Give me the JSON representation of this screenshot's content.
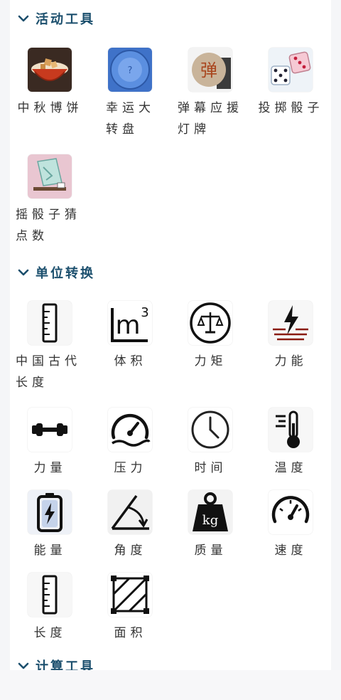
{
  "sections": [
    {
      "title": "活动工具",
      "items": [
        {
          "label": "中秋博饼"
        },
        {
          "label": "幸运大转盘"
        },
        {
          "label": "弹幕应援灯牌"
        },
        {
          "label": "投掷骰子"
        },
        {
          "label": "摇骰子猜点数"
        }
      ]
    },
    {
      "title": "单位转换",
      "items": [
        {
          "label": "中国古代长度"
        },
        {
          "label": "体积"
        },
        {
          "label": "力矩"
        },
        {
          "label": "力能"
        },
        {
          "label": "力量"
        },
        {
          "label": "压力"
        },
        {
          "label": "时间"
        },
        {
          "label": "温度"
        },
        {
          "label": "能量"
        },
        {
          "label": "角度"
        },
        {
          "label": "质量"
        },
        {
          "label": "速度"
        },
        {
          "label": "长度"
        },
        {
          "label": "面积"
        }
      ]
    },
    {
      "title": "计算工具"
    }
  ],
  "icons": {
    "danmu_char": "弹",
    "volume_text": "m",
    "volume_sup": "3",
    "mass_text": "kg"
  },
  "colors": {
    "accent": "#1b4f6d",
    "background": "#f5f6f8",
    "panel": "#ffffff"
  }
}
